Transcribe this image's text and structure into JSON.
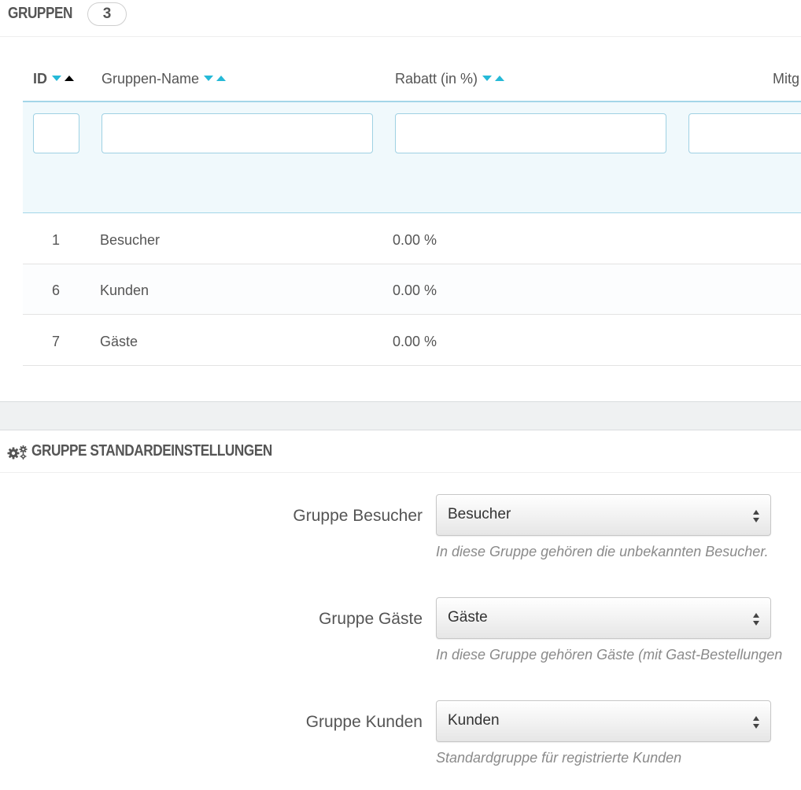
{
  "list": {
    "title": "GRUPPEN",
    "count": "3",
    "columns": {
      "id": "ID",
      "name": "Gruppen-Name",
      "discount": "Rabatt (in %)",
      "members": "Mitg"
    },
    "rows": [
      {
        "id": "1",
        "name": "Besucher",
        "discount": "0.00 %"
      },
      {
        "id": "6",
        "name": "Kunden",
        "discount": "0.00 %"
      },
      {
        "id": "7",
        "name": "Gäste",
        "discount": "0.00 %"
      }
    ]
  },
  "settings": {
    "title": "GRUPPE STANDARDEINSTELLUNGEN",
    "icon": "gears-icon",
    "fields": [
      {
        "label": "Gruppe Besucher",
        "value": "Besucher",
        "help": "In diese Gruppe gehören die unbekannten Besucher."
      },
      {
        "label": "Gruppe Gäste",
        "value": "Gäste",
        "help": "In diese Gruppe gehören Gäste (mit Gast-Bestellungen"
      },
      {
        "label": "Gruppe Kunden",
        "value": "Kunden",
        "help": "Standardgruppe für registrierte Kunden"
      }
    ]
  },
  "colors": {
    "accent": "#25b9d7",
    "filter_bg": "#f0f9fc",
    "text": "#555555",
    "help_text": "#8a8a8a"
  }
}
